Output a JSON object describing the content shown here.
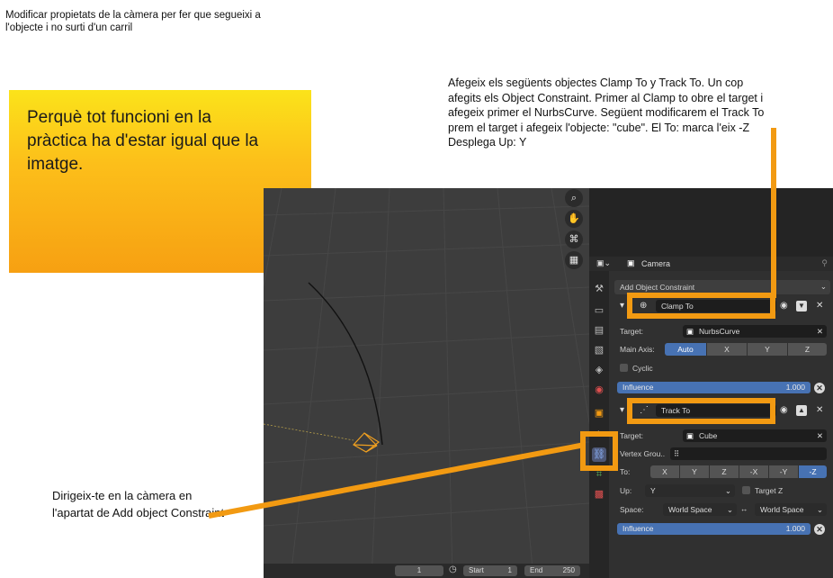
{
  "top_text": "Modificar propietats de la càmera per fer que segueixi a l'objecte i no surti d'un carril",
  "instructions": "Afegeix els següents objectes Clamp To y Track To. Un cop afegits els Object Constraint. Primer al Clamp to obre el target i afegeix primer el NurbsCurve. Següent modificarem el Track To prem el target i afegeix l'objecte: \"cube\". El To: marca l'eix -Z Desplega Up: Y",
  "callout": "Perquè tot funcioni en la pràctica ha d'estar igual que la imatge.",
  "bottom_note": "Dirigeix-te en la càmera en l'apartat de Add object Constraint",
  "colors": {
    "orange": "#f29a12",
    "accent_blue": "#4772b3",
    "callout_gradient": [
      "#fbe31a",
      "#f7a012"
    ]
  },
  "viewport": {
    "timeline": {
      "current_frame": "1",
      "start_label": "Start",
      "start": "1",
      "end_label": "End",
      "end": "250"
    },
    "nav_icons": [
      "zoom-icon",
      "hand-icon",
      "camera-view-icon",
      "grid-icon"
    ]
  },
  "properties": {
    "object_name": "Camera",
    "add_constraint": "Add Object Constraint",
    "clamp_to": {
      "name": "Clamp To",
      "target_label": "Target:",
      "target_value": "NurbsCurve",
      "main_axis_label": "Main Axis:",
      "axes": [
        "Auto",
        "X",
        "Y",
        "Z"
      ],
      "selected_axis": "Auto",
      "cyclic_label": "Cyclic",
      "influence_label": "Influence",
      "influence_value": "1.000"
    },
    "track_to": {
      "name": "Track To",
      "target_label": "Target:",
      "target_value": "Cube",
      "vertex_group_label": "Vertex Grou..",
      "to_label": "To:",
      "to_options": [
        "X",
        "Y",
        "Z",
        "-X",
        "-Y",
        "-Z"
      ],
      "to_selected": "-Z",
      "up_label": "Up:",
      "up_value": "Y",
      "target_z_label": "Target Z",
      "space_label": "Space:",
      "space_from": "World Space",
      "space_to": "World Space",
      "influence_label": "Influence",
      "influence_value": "1.000"
    }
  }
}
